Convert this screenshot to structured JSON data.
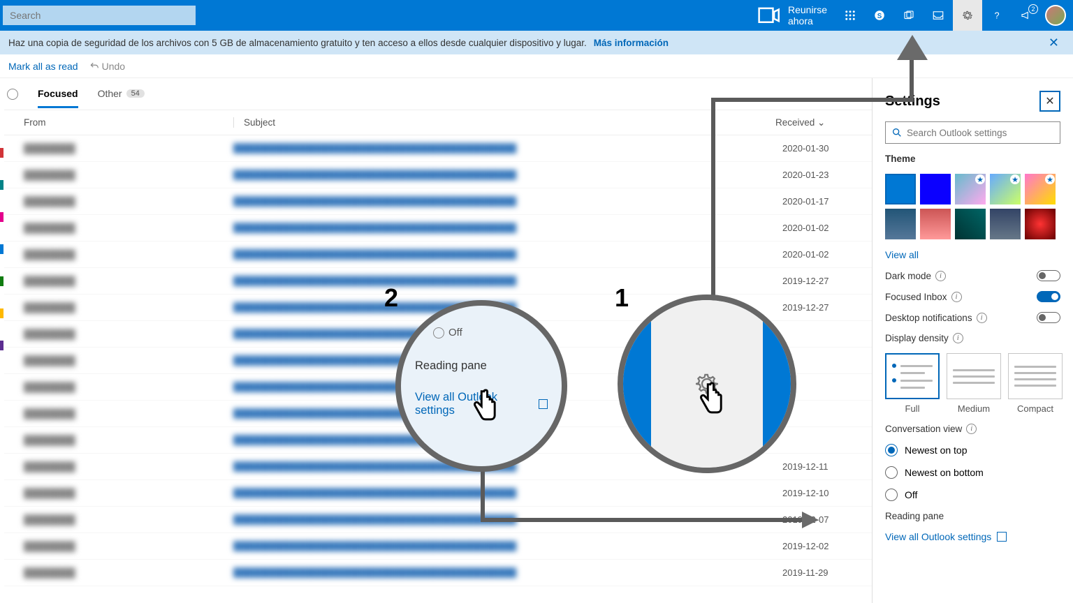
{
  "topbar": {
    "search_placeholder": "Search",
    "meet_now": "Reunirse ahora",
    "notification_count": "2"
  },
  "banner": {
    "text": "Haz una copia de seguridad de los archivos con 5 GB de almacenamiento gratuito y ten acceso a ellos desde cualquier dispositivo y lugar.",
    "link": "Más información"
  },
  "actions": {
    "mark_read": "Mark all as read",
    "undo": "Undo"
  },
  "tabs": {
    "focused": "Focused",
    "other": "Other",
    "other_count": "54"
  },
  "headers": {
    "from": "From",
    "subject": "Subject",
    "received": "Received"
  },
  "mails": [
    {
      "date": "2020-01-30"
    },
    {
      "date": "2020-01-23"
    },
    {
      "date": "2020-01-17"
    },
    {
      "date": "2020-01-02"
    },
    {
      "date": "2020-01-02"
    },
    {
      "date": "2019-12-27"
    },
    {
      "date": "2019-12-27"
    },
    {
      "date": ""
    },
    {
      "date": ""
    },
    {
      "date": ""
    },
    {
      "date": ""
    },
    {
      "date": ""
    },
    {
      "date": "2019-12-11"
    },
    {
      "date": "2019-12-10"
    },
    {
      "date": "2019-12-07"
    },
    {
      "date": "2019-12-02"
    },
    {
      "date": "2019-11-29"
    }
  ],
  "settings": {
    "title": "Settings",
    "search_placeholder": "Search Outlook settings",
    "theme_label": "Theme",
    "view_all": "View all",
    "dark_mode": "Dark mode",
    "focused_inbox": "Focused Inbox",
    "desktop_notif": "Desktop notifications",
    "density": "Display density",
    "density_full": "Full",
    "density_medium": "Medium",
    "density_compact": "Compact",
    "conv_view": "Conversation view",
    "newest_top": "Newest on top",
    "newest_bottom": "Newest on bottom",
    "conv_off": "Off",
    "reading_pane": "Reading pane",
    "view_all_settings": "View all Outlook settings"
  },
  "callout": {
    "num1": "1",
    "num2": "2",
    "off": "Off",
    "reading_pane": "Reading pane",
    "link": "View all Outlook settings"
  }
}
